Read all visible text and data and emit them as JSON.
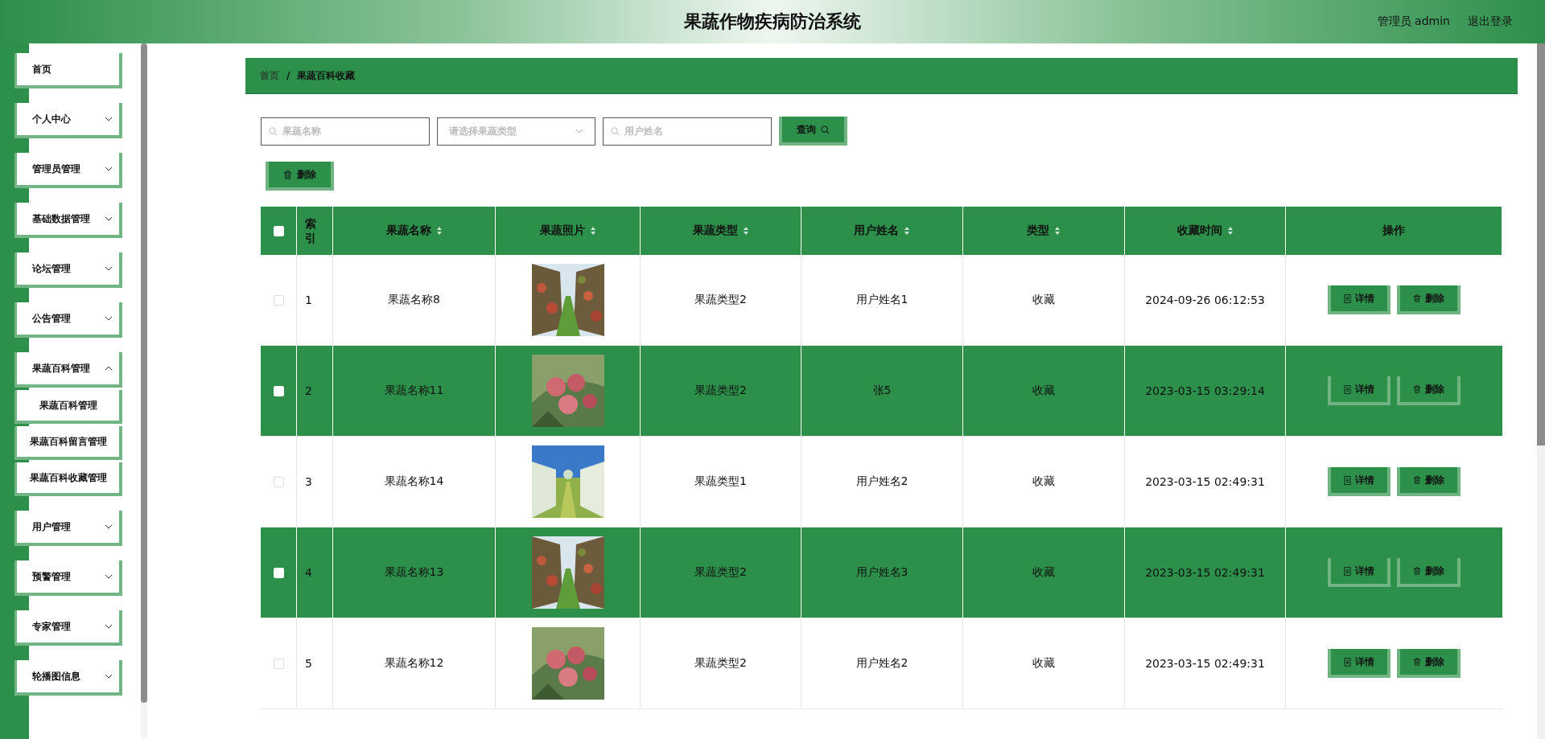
{
  "header": {
    "title": "果蔬作物疾病防治系统",
    "user": "管理员 admin",
    "logout": "退出登录"
  },
  "sidebar": {
    "items": [
      {
        "label": "首页"
      },
      {
        "label": "个人中心",
        "expanded": false
      },
      {
        "label": "管理员管理",
        "expanded": false
      },
      {
        "label": "基础数据管理",
        "expanded": false
      },
      {
        "label": "论坛管理",
        "expanded": false
      },
      {
        "label": "公告管理",
        "expanded": false
      },
      {
        "label": "果蔬百科管理",
        "expanded": true,
        "children": [
          {
            "label": "果蔬百科管理"
          },
          {
            "label": "果蔬百科留言管理"
          },
          {
            "label": "果蔬百科收藏管理"
          }
        ]
      },
      {
        "label": "用户管理",
        "expanded": false
      },
      {
        "label": "预警管理",
        "expanded": false
      },
      {
        "label": "专家管理",
        "expanded": false
      },
      {
        "label": "轮播图信息",
        "expanded": false
      }
    ]
  },
  "breadcrumb": [
    {
      "label": "首页",
      "selected": false
    },
    {
      "label": "果蔬百科收藏",
      "selected": true
    }
  ],
  "breadcrumb_separator": "/",
  "filters": [
    {
      "kind": "search",
      "placeholder": "果蔬名称"
    },
    {
      "kind": "select",
      "placeholder": "请选择果蔬类型"
    },
    {
      "kind": "search",
      "placeholder": "用户姓名"
    }
  ],
  "query_button": "查询",
  "delete_button": "删除",
  "table": {
    "all_checked": false,
    "columns": [
      {
        "label": "索引",
        "sortable": false
      },
      {
        "label": "果蔬名称",
        "sortable": true
      },
      {
        "label": "果蔬照片",
        "sortable": true
      },
      {
        "label": "果蔬类型",
        "sortable": true
      },
      {
        "label": "用户姓名",
        "sortable": true
      },
      {
        "label": "类型",
        "sortable": true
      },
      {
        "label": "收藏时间",
        "sortable": true
      },
      {
        "label": "操作",
        "sortable": false
      }
    ],
    "rows": [
      {
        "checked": false,
        "index": "1",
        "name": "果蔬名称8",
        "photo": {
          "kind": "picture"
        },
        "type": "果蔬类型2",
        "user": "用户姓名1",
        "kind": "收藏",
        "time": "2024-09-26 06:12:53",
        "actions": [
          "详情",
          "删除"
        ]
      },
      {
        "checked": false,
        "index": "2",
        "name": "果蔬名称11",
        "photo": {
          "kind": "picture"
        },
        "type": "果蔬类型2",
        "user": "张5",
        "kind": "收藏",
        "time": "2023-03-15 03:29:14",
        "actions": [
          "详情",
          "删除"
        ]
      },
      {
        "checked": false,
        "index": "3",
        "name": "果蔬名称14",
        "photo": {
          "kind": "picture"
        },
        "type": "果蔬类型1",
        "user": "用户姓名2",
        "kind": "收藏",
        "time": "2023-03-15 02:49:31",
        "actions": [
          "详情",
          "删除"
        ]
      },
      {
        "checked": false,
        "index": "4",
        "name": "果蔬名称13",
        "photo": {
          "kind": "picture"
        },
        "type": "果蔬类型2",
        "user": "用户姓名3",
        "kind": "收藏",
        "time": "2023-03-15 02:49:31",
        "actions": [
          "详情",
          "删除"
        ]
      },
      {
        "checked": false,
        "index": "5",
        "name": "果蔬名称12",
        "photo": {
          "kind": "picture"
        },
        "type": "果蔬类型2",
        "user": "用户姓名2",
        "kind": "收藏",
        "time": "2023-03-15 02:49:31",
        "actions": [
          "详情",
          "删除"
        ]
      }
    ]
  }
}
